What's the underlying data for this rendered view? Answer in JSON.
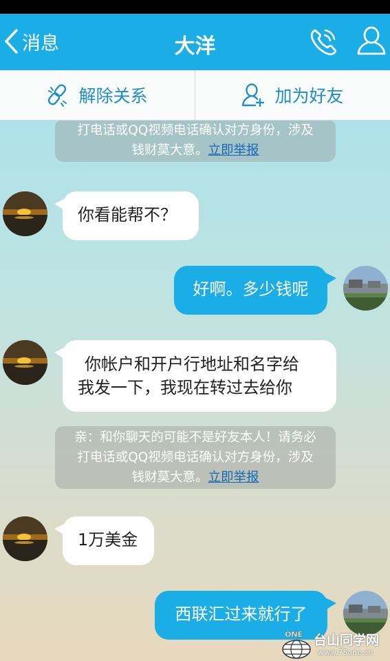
{
  "header": {
    "back_label": "消息",
    "title": "大洋",
    "phone_icon": "phone-icon",
    "profile_icon": "profile-icon"
  },
  "actions": {
    "unlink_label": "解除关系",
    "add_friend_label": "加为好友"
  },
  "notices": [
    {
      "lines": [
        "打电话或QQ视频电话确认对方身份，涉及"
      ],
      "tail": "钱财莫大意。",
      "link": "立即举报"
    },
    {
      "lines": [
        "亲：和你聊天的可能不是好友本人！请务必",
        "打电话或QQ视频电话确认对方身份，涉及"
      ],
      "tail": "钱财莫大意。",
      "link": "立即举报"
    }
  ],
  "messages": [
    {
      "direction": "in",
      "text": "你看能帮不？"
    },
    {
      "direction": "out",
      "text": "好啊。多少钱呢"
    },
    {
      "direction": "in",
      "lines": [
        "你帐户和开户行地址和名字给",
        "我发一下，我现在转过去给你"
      ]
    },
    {
      "direction": "in",
      "text": "1万美金"
    },
    {
      "direction": "out",
      "text": "西联汇过来就行了"
    }
  ],
  "watermark": {
    "badge": "ONE",
    "site": "台山同学网",
    "url": "www.75one.cn"
  },
  "colors": {
    "accent": "#1baee6",
    "link": "#1767b8",
    "action_text": "#1f8ec7"
  }
}
